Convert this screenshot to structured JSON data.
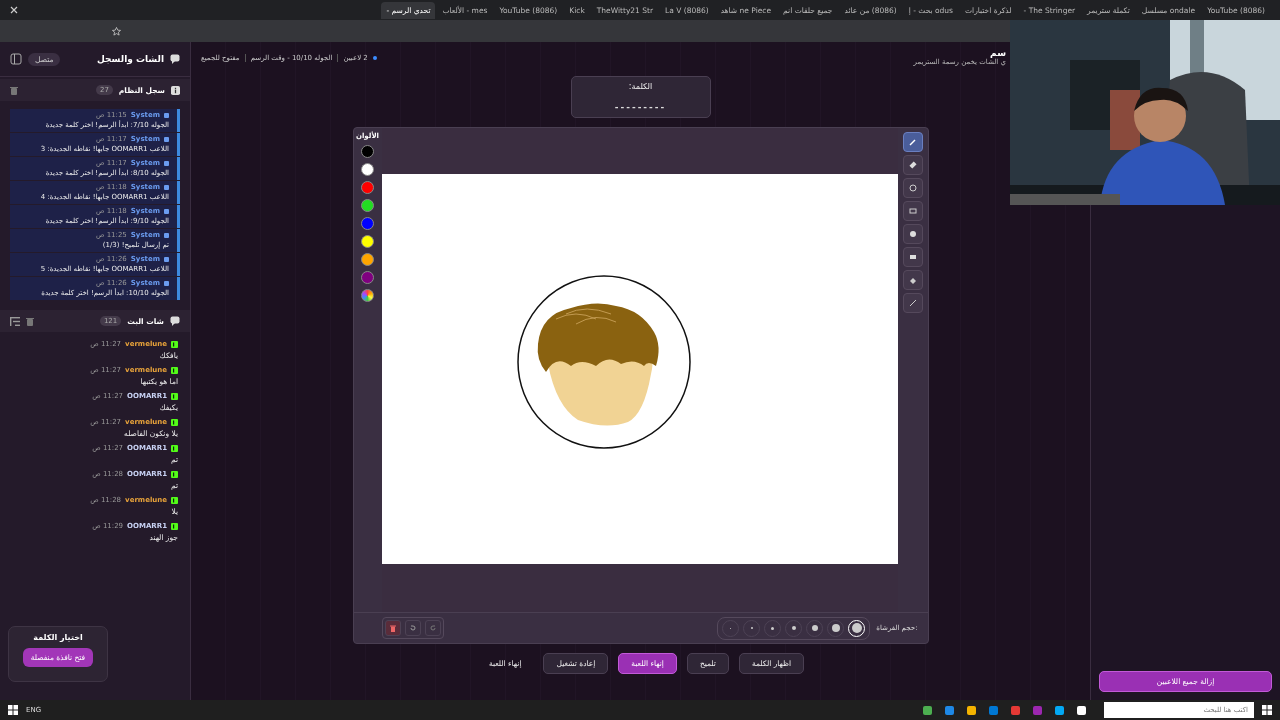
{
  "browser": {
    "tabs": [
      {
        "title": "(8086) YouTube",
        "selected": false
      },
      {
        "title": "ondale مسلسل",
        "selected": false
      },
      {
        "title": "تكملة ستريمر",
        "selected": false
      },
      {
        "title": "The Stringer -",
        "selected": false
      },
      {
        "title": "لذكرة اختبارات",
        "selected": false
      },
      {
        "title": "odus بحث - إ",
        "selected": false
      },
      {
        "title": "(8086) من عائد",
        "selected": false
      },
      {
        "title": "جميع حلقات انم",
        "selected": false
      },
      {
        "title": "ne Piece شاهد",
        "selected": false
      },
      {
        "title": "(8086) La V",
        "selected": false
      },
      {
        "title": "TheWitty21 Str",
        "selected": false
      },
      {
        "title": "Kick",
        "selected": false
      },
      {
        "title": "(8086) YouTube",
        "selected": false
      },
      {
        "title": "mes - الألعاب",
        "selected": false
      },
      {
        "title": "تحدي الرسم -",
        "selected": true
      }
    ]
  },
  "header": {
    "title": "الشات والسجل",
    "status": "متصل"
  },
  "system_log": {
    "title": "سجل النظام",
    "count": "27",
    "entries": [
      {
        "author": "System",
        "time": "11:15 ص",
        "text": "الجوله 7/10: ابدأ الرسم! اختر كلمة جديدة"
      },
      {
        "author": "System",
        "time": "11:17 ص",
        "text": "اللاعب OOMARR1 جابها! نقاطه الجديدة: 3"
      },
      {
        "author": "System",
        "time": "11:17 ص",
        "text": "الجوله 8/10: ابدأ الرسم! اختر كلمة جديدة"
      },
      {
        "author": "System",
        "time": "11:18 ص",
        "text": "اللاعب OOMARR1 جابها! نقاطه الجديدة: 4"
      },
      {
        "author": "System",
        "time": "11:18 ص",
        "text": "الجوله 9/10: ابدأ الرسم! اختر كلمة جديدة"
      },
      {
        "author": "System",
        "time": "11:25 ص",
        "text": "تم إرسال تلميح! (1/3)"
      },
      {
        "author": "System",
        "time": "11:26 ص",
        "text": "اللاعب OOMARR1 جابها! نقاطه الجديدة: 5"
      },
      {
        "author": "System",
        "time": "11:26 ص",
        "text": "الجوله 10/10: ابدأ الرسم! اختر كلمة جديدة"
      }
    ]
  },
  "stream_chat": {
    "title": "شات البث",
    "count": "121",
    "messages": [
      {
        "user": "vermelune",
        "color": "#e8a33a",
        "time": "11:27 ص",
        "text": "يافكك"
      },
      {
        "user": "vermelune",
        "color": "#e8a33a",
        "time": "11:27 ص",
        "text": "اما هو يكتبها"
      },
      {
        "user": "OOMARR1",
        "color": "#c9d3f5",
        "time": "11:27 ص",
        "text": "يكيفك"
      },
      {
        "user": "vermelune",
        "color": "#e8a33a",
        "time": "11:27 ص",
        "text": "يلا ونكون الفاصله"
      },
      {
        "user": "OOMARR1",
        "color": "#c9d3f5",
        "time": "11:27 ص",
        "text": "تم"
      },
      {
        "user": "OOMARR1",
        "color": "#c9d3f5",
        "time": "11:28 ص",
        "text": "تم"
      },
      {
        "user": "vermelune",
        "color": "#e8a33a",
        "time": "11:28 ص",
        "text": "يلا"
      },
      {
        "user": "OOMARR1",
        "color": "#c9d3f5",
        "time": "11:29 ص",
        "text": "جوز الهند"
      }
    ]
  },
  "word_popup": {
    "title": "اختيار الكلمة",
    "button": "فتح نافذة منفصلة"
  },
  "game_bar": {
    "players": "2 لاعبين",
    "round": "الجوله 10/10 - وقت الرسم",
    "access": "مفتوح للجميع"
  },
  "page_title": {
    "title": "سم",
    "subtitle": "ي الشات يخمن رسمة الستريمر"
  },
  "word_card": {
    "label": "الكلمة:",
    "hint": "---------"
  },
  "palette": {
    "label": "الألوان",
    "colors": [
      {
        "color": "#000000"
      },
      {
        "color": "#ffffff"
      },
      {
        "color": "#ff0000"
      },
      {
        "color": "#22dd22"
      },
      {
        "color": "#0000ff"
      },
      {
        "color": "#ffff00"
      },
      {
        "color": "#ffa500"
      },
      {
        "color": "#800080"
      },
      {
        "kind": "rainbow"
      }
    ]
  },
  "tools": [
    {
      "kind": "pen",
      "selected": true
    },
    {
      "kind": "eraser",
      "selected": false
    },
    {
      "kind": "circle",
      "selected": false
    },
    {
      "kind": "rectangle",
      "selected": false
    },
    {
      "kind": "filled-circle",
      "selected": false
    },
    {
      "kind": "filled-rectangle",
      "selected": false
    },
    {
      "kind": "fill",
      "selected": false
    },
    {
      "kind": "line",
      "selected": false
    }
  ],
  "brush": {
    "label": "حجم الفرشاة:",
    "sizes": [
      {
        "selected": true
      },
      {
        "selected": false
      },
      {
        "selected": false
      },
      {
        "selected": false
      },
      {
        "selected": false
      },
      {
        "selected": false
      },
      {
        "selected": false
      }
    ]
  },
  "actions": [
    {
      "label": "اظهار الكلمة",
      "kind": "secondary"
    },
    {
      "label": "تلميح",
      "kind": "secondary"
    },
    {
      "label": "إنهاء اللعبة",
      "kind": "primary"
    },
    {
      "label": "إعادة تشغيل",
      "kind": "secondary"
    },
    {
      "label": "إنهاء اللعبة",
      "kind": "plain"
    }
  ],
  "right_panel": {
    "button": "إزالة جميع اللاعبين"
  },
  "taskbar": {
    "search_placeholder": "اكتب هنا للبحث",
    "language": "ENG"
  }
}
